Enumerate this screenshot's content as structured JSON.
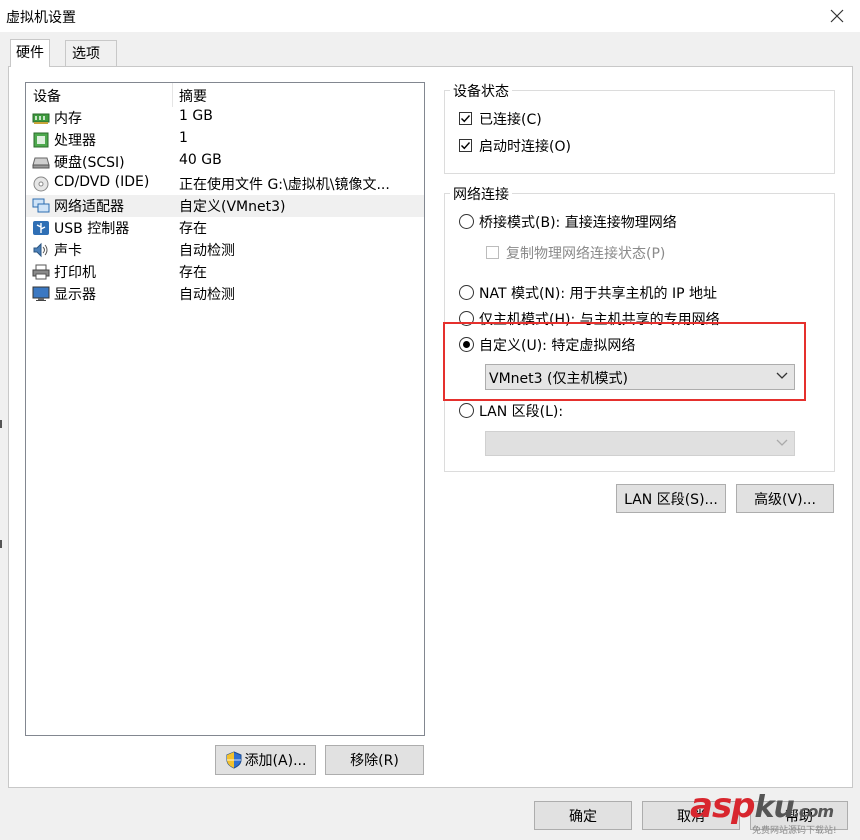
{
  "window": {
    "title": "虚拟机设置"
  },
  "tabs": [
    {
      "label": "硬件",
      "active": true
    },
    {
      "label": "选项",
      "active": false
    }
  ],
  "device_table": {
    "headers": [
      "设备",
      "摘要"
    ],
    "rows": [
      {
        "device": "内存",
        "summary": "1 GB",
        "icon": "memory-icon"
      },
      {
        "device": "处理器",
        "summary": "1",
        "icon": "processor-icon"
      },
      {
        "device": "硬盘(SCSI)",
        "summary": "40 GB",
        "icon": "hard-disk-icon"
      },
      {
        "device": "CD/DVD (IDE)",
        "summary": "正在使用文件 G:\\虚拟机\\镜像文...",
        "icon": "cd-dvd-icon"
      },
      {
        "device": "网络适配器",
        "summary": "自定义(VMnet3)",
        "icon": "network-adapter-icon",
        "selected": true
      },
      {
        "device": "USB 控制器",
        "summary": "存在",
        "icon": "usb-icon"
      },
      {
        "device": "声卡",
        "summary": "自动检测",
        "icon": "sound-card-icon"
      },
      {
        "device": "打印机",
        "summary": "存在",
        "icon": "printer-icon"
      },
      {
        "device": "显示器",
        "summary": "自动检测",
        "icon": "display-icon"
      }
    ]
  },
  "list_buttons": {
    "add": "添加(A)...",
    "remove": "移除(R)"
  },
  "device_status": {
    "title": "设备状态",
    "connected": {
      "label": "已连接(C)",
      "checked": true
    },
    "connect_at_power_on": {
      "label": "启动时连接(O)",
      "checked": true
    }
  },
  "network_connection": {
    "title": "网络连接",
    "bridged": {
      "label": "桥接模式(B): 直接连接物理网络",
      "selected": false
    },
    "replicate": {
      "label": "复制物理网络连接状态(P)",
      "checked": false,
      "disabled": true
    },
    "nat": {
      "label": "NAT 模式(N): 用于共享主机的 IP 地址",
      "selected": false
    },
    "host_only": {
      "label": "仅主机模式(H): 与主机共享的专用网络",
      "selected": false
    },
    "custom": {
      "label": "自定义(U): 特定虚拟网络",
      "selected": true,
      "value": "VMnet3 (仅主机模式)"
    },
    "lan_segment": {
      "label": "LAN 区段(L):",
      "selected": false,
      "value": ""
    }
  },
  "network_buttons": {
    "lan_segments": "LAN 区段(S)...",
    "advanced": "高级(V)..."
  },
  "footer": {
    "ok": "确定",
    "cancel": "取消",
    "help": "帮助"
  },
  "watermark": {
    "main_a": "asp",
    "main_b": "ku",
    "main_c": ".com",
    "sub": "免费网站源码下载站!"
  },
  "colors": {
    "highlight_box": "#e5302d",
    "selected_row": "#f0f0f0",
    "watermark_red": "#d8262e"
  }
}
